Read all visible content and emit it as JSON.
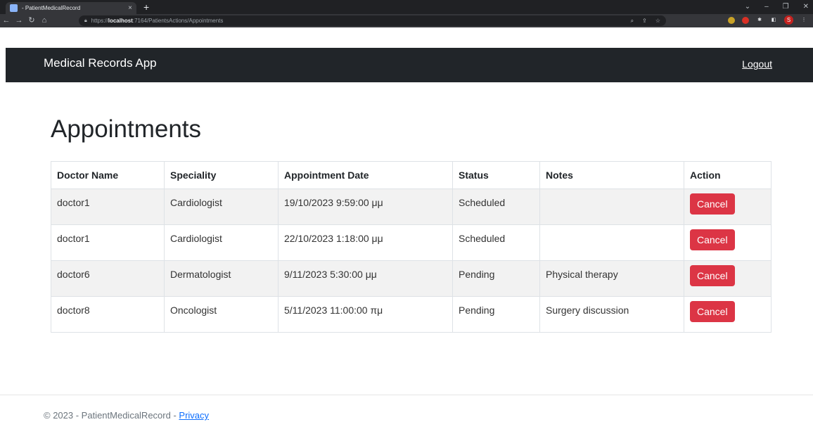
{
  "browser": {
    "tab_title": "- PatientMedicalRecord",
    "tab_close": "×",
    "new_tab": "+",
    "url_scheme": "https://",
    "url_host": "localhost",
    "url_path": ":7164/PatientsActions/Appointments",
    "profile_initial": "S"
  },
  "navbar": {
    "brand": "Medical Records App",
    "logout": "Logout"
  },
  "page": {
    "title": "Appointments"
  },
  "table": {
    "headers": [
      "Doctor Name",
      "Speciality",
      "Appointment Date",
      "Status",
      "Notes",
      "Action"
    ],
    "rows": [
      {
        "doctor": "doctor1",
        "speciality": "Cardiologist",
        "date": "19/10/2023 9:59:00 μμ",
        "status": "Scheduled",
        "notes": "",
        "action": "Cancel"
      },
      {
        "doctor": "doctor1",
        "speciality": "Cardiologist",
        "date": "22/10/2023 1:18:00 μμ",
        "status": "Scheduled",
        "notes": "",
        "action": "Cancel"
      },
      {
        "doctor": "doctor6",
        "speciality": "Dermatologist",
        "date": "9/11/2023 5:30:00 μμ",
        "status": "Pending",
        "notes": "Physical therapy",
        "action": "Cancel"
      },
      {
        "doctor": "doctor8",
        "speciality": "Oncologist",
        "date": "5/11/2023 11:00:00 πμ",
        "status": "Pending",
        "notes": "Surgery discussion",
        "action": "Cancel"
      }
    ]
  },
  "footer": {
    "text": "© 2023 - PatientMedicalRecord - ",
    "privacy": "Privacy"
  },
  "colors": {
    "navbar_bg": "#212529",
    "cancel_button": "#dc3545",
    "link": "#0d6efd"
  }
}
